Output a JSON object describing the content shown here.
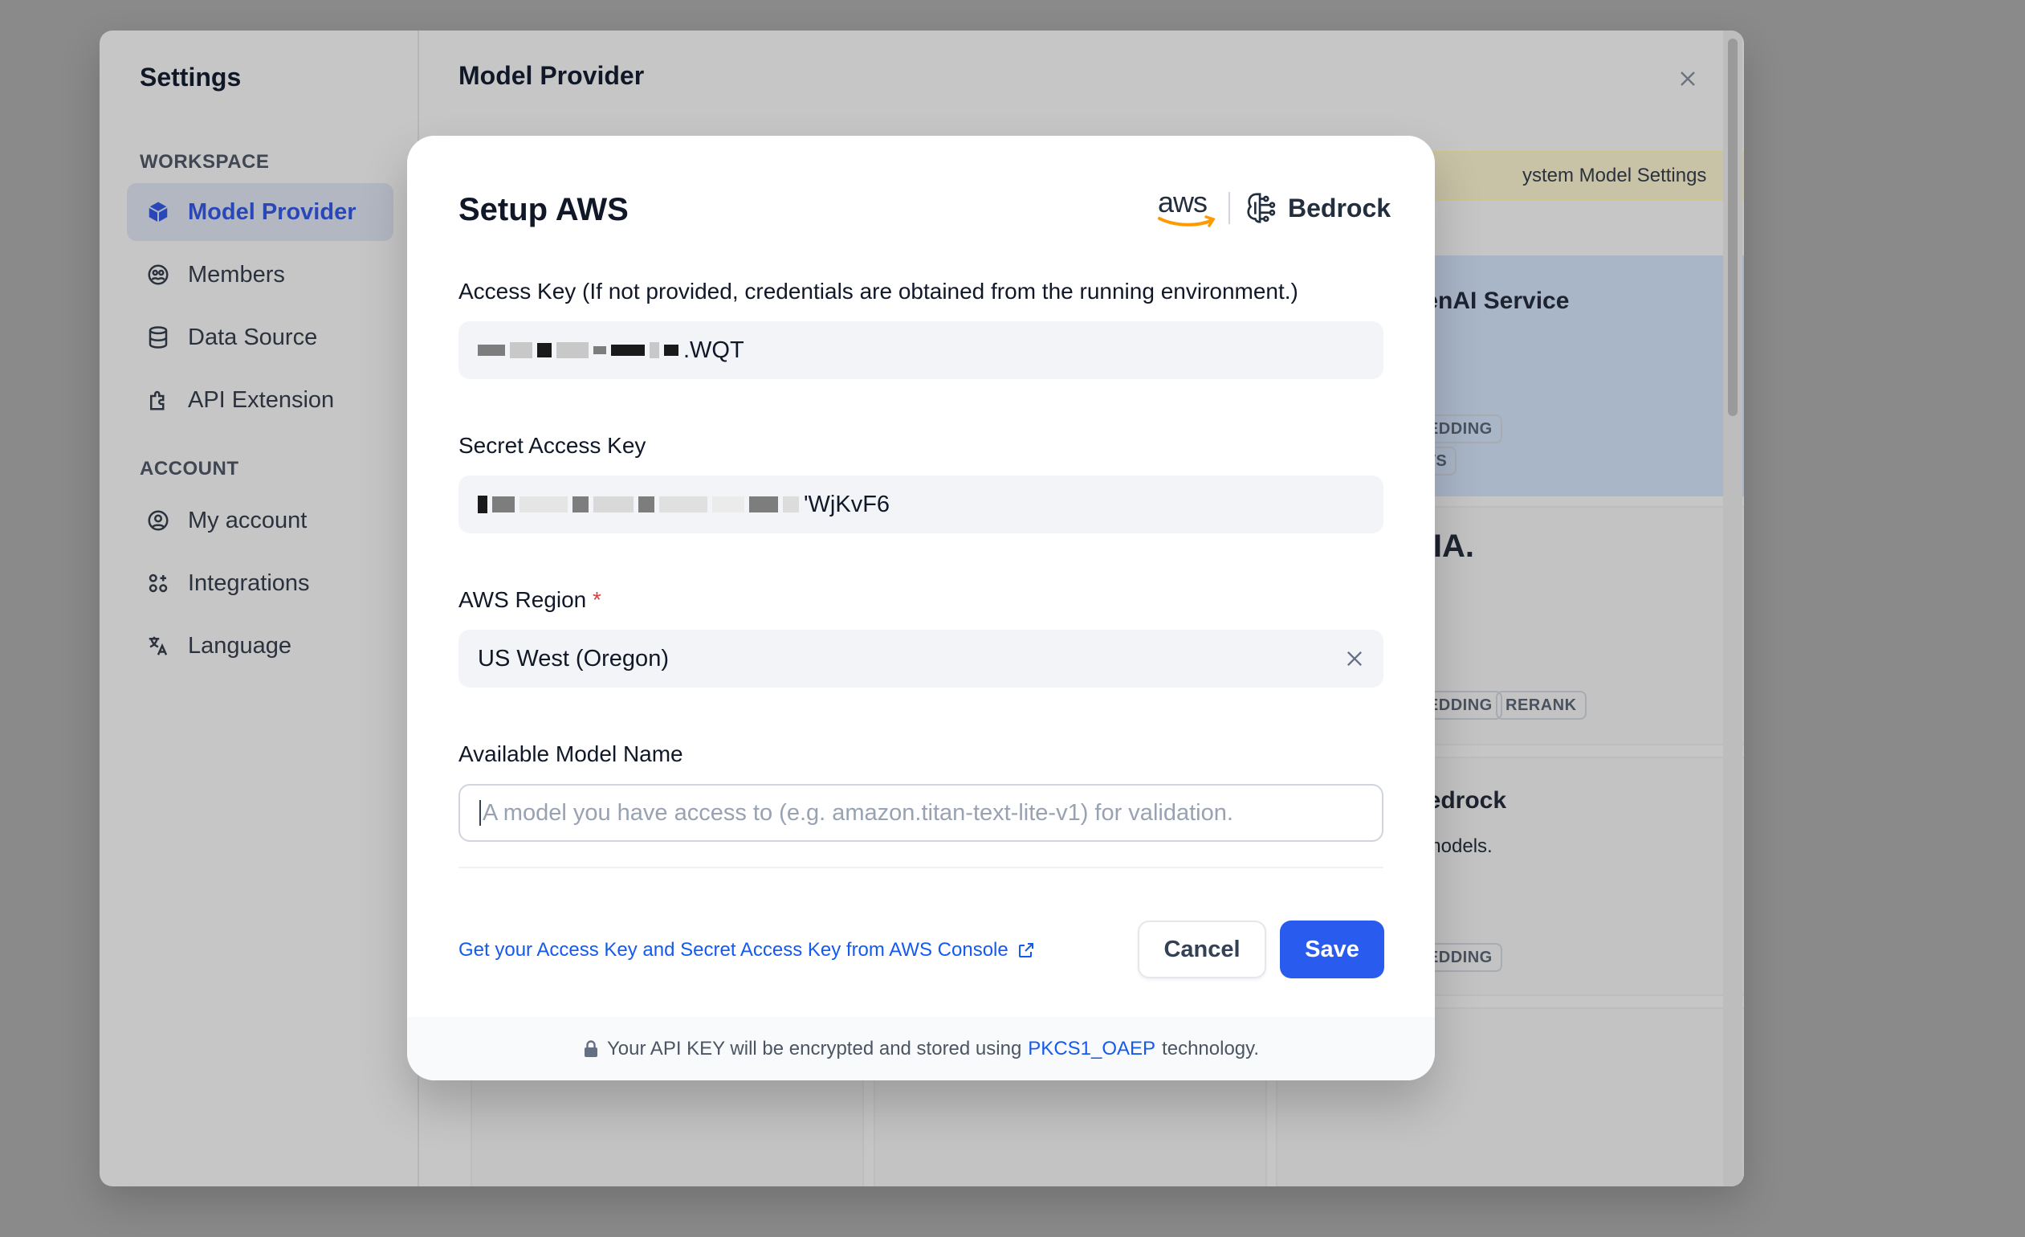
{
  "settings": {
    "title": "Settings",
    "workspace_label": "WORKSPACE",
    "account_label": "ACCOUNT",
    "workspace_items": [
      {
        "label": "Model Provider",
        "icon": "cube-icon",
        "active": true
      },
      {
        "label": "Members",
        "icon": "members-icon",
        "active": false
      },
      {
        "label": "Data Source",
        "icon": "database-icon",
        "active": false
      },
      {
        "label": "API Extension",
        "icon": "puzzle-icon",
        "active": false
      }
    ],
    "account_items": [
      {
        "label": "My account",
        "icon": "user-circle-icon"
      },
      {
        "label": "Integrations",
        "icon": "grid-icon"
      },
      {
        "label": "Language",
        "icon": "translate-icon"
      }
    ]
  },
  "main": {
    "title": "Model Provider",
    "system_model_button": "ystem Model Settings",
    "cards": [
      {
        "name": "penAI Service",
        "tags": [
          "BEDDING",
          "TTS"
        ]
      },
      {
        "name": "DIA.",
        "tags": [
          "BEDDING",
          "RERANK"
        ]
      },
      {
        "name": "Bedrock",
        "desc": "s models.",
        "tags": [
          "BEDDING"
        ]
      }
    ]
  },
  "modal": {
    "title": "Setup AWS",
    "logo_aws": "aws",
    "logo_bedrock": "Bedrock",
    "access_key": {
      "label": "Access Key (If not provided, credentials are obtained from the running environment.)",
      "value_suffix": ".WQT"
    },
    "secret_key": {
      "label": "Secret Access Key",
      "value_suffix": "'WjKvF6"
    },
    "region": {
      "label": "AWS Region",
      "required_mark": "*",
      "value": "US West (Oregon)"
    },
    "model_name": {
      "label": "Available Model Name",
      "placeholder": "A model you have access to (e.g. amazon.titan-text-lite-v1) for validation."
    },
    "console_link": "Get your Access Key and Secret Access Key from AWS Console",
    "cancel_label": "Cancel",
    "save_label": "Save",
    "footer": {
      "prefix": "Your API KEY will be encrypted and stored using",
      "highlight": "PKCS1_OAEP",
      "suffix": "technology."
    }
  },
  "colors": {
    "accent": "#2a5bef",
    "link": "#155aef",
    "active_nav": "#2a47b8"
  }
}
